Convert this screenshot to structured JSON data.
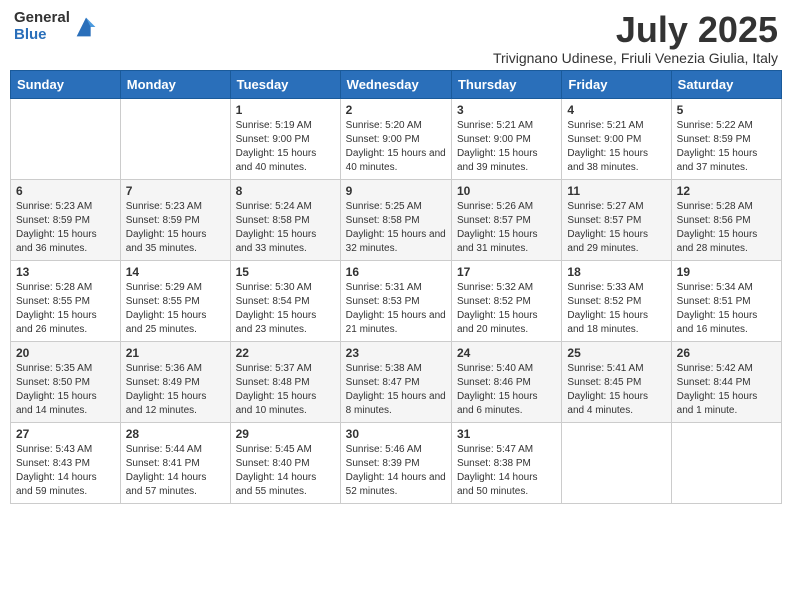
{
  "header": {
    "logo_general": "General",
    "logo_blue": "Blue",
    "month_title": "July 2025",
    "subtitle": "Trivignano Udinese, Friuli Venezia Giulia, Italy"
  },
  "days_of_week": [
    "Sunday",
    "Monday",
    "Tuesday",
    "Wednesday",
    "Thursday",
    "Friday",
    "Saturday"
  ],
  "weeks": [
    [
      {
        "day": "",
        "info": ""
      },
      {
        "day": "",
        "info": ""
      },
      {
        "day": "1",
        "info": "Sunrise: 5:19 AM\nSunset: 9:00 PM\nDaylight: 15 hours and 40 minutes."
      },
      {
        "day": "2",
        "info": "Sunrise: 5:20 AM\nSunset: 9:00 PM\nDaylight: 15 hours and 40 minutes."
      },
      {
        "day": "3",
        "info": "Sunrise: 5:21 AM\nSunset: 9:00 PM\nDaylight: 15 hours and 39 minutes."
      },
      {
        "day": "4",
        "info": "Sunrise: 5:21 AM\nSunset: 9:00 PM\nDaylight: 15 hours and 38 minutes."
      },
      {
        "day": "5",
        "info": "Sunrise: 5:22 AM\nSunset: 8:59 PM\nDaylight: 15 hours and 37 minutes."
      }
    ],
    [
      {
        "day": "6",
        "info": "Sunrise: 5:23 AM\nSunset: 8:59 PM\nDaylight: 15 hours and 36 minutes."
      },
      {
        "day": "7",
        "info": "Sunrise: 5:23 AM\nSunset: 8:59 PM\nDaylight: 15 hours and 35 minutes."
      },
      {
        "day": "8",
        "info": "Sunrise: 5:24 AM\nSunset: 8:58 PM\nDaylight: 15 hours and 33 minutes."
      },
      {
        "day": "9",
        "info": "Sunrise: 5:25 AM\nSunset: 8:58 PM\nDaylight: 15 hours and 32 minutes."
      },
      {
        "day": "10",
        "info": "Sunrise: 5:26 AM\nSunset: 8:57 PM\nDaylight: 15 hours and 31 minutes."
      },
      {
        "day": "11",
        "info": "Sunrise: 5:27 AM\nSunset: 8:57 PM\nDaylight: 15 hours and 29 minutes."
      },
      {
        "day": "12",
        "info": "Sunrise: 5:28 AM\nSunset: 8:56 PM\nDaylight: 15 hours and 28 minutes."
      }
    ],
    [
      {
        "day": "13",
        "info": "Sunrise: 5:28 AM\nSunset: 8:55 PM\nDaylight: 15 hours and 26 minutes."
      },
      {
        "day": "14",
        "info": "Sunrise: 5:29 AM\nSunset: 8:55 PM\nDaylight: 15 hours and 25 minutes."
      },
      {
        "day": "15",
        "info": "Sunrise: 5:30 AM\nSunset: 8:54 PM\nDaylight: 15 hours and 23 minutes."
      },
      {
        "day": "16",
        "info": "Sunrise: 5:31 AM\nSunset: 8:53 PM\nDaylight: 15 hours and 21 minutes."
      },
      {
        "day": "17",
        "info": "Sunrise: 5:32 AM\nSunset: 8:52 PM\nDaylight: 15 hours and 20 minutes."
      },
      {
        "day": "18",
        "info": "Sunrise: 5:33 AM\nSunset: 8:52 PM\nDaylight: 15 hours and 18 minutes."
      },
      {
        "day": "19",
        "info": "Sunrise: 5:34 AM\nSunset: 8:51 PM\nDaylight: 15 hours and 16 minutes."
      }
    ],
    [
      {
        "day": "20",
        "info": "Sunrise: 5:35 AM\nSunset: 8:50 PM\nDaylight: 15 hours and 14 minutes."
      },
      {
        "day": "21",
        "info": "Sunrise: 5:36 AM\nSunset: 8:49 PM\nDaylight: 15 hours and 12 minutes."
      },
      {
        "day": "22",
        "info": "Sunrise: 5:37 AM\nSunset: 8:48 PM\nDaylight: 15 hours and 10 minutes."
      },
      {
        "day": "23",
        "info": "Sunrise: 5:38 AM\nSunset: 8:47 PM\nDaylight: 15 hours and 8 minutes."
      },
      {
        "day": "24",
        "info": "Sunrise: 5:40 AM\nSunset: 8:46 PM\nDaylight: 15 hours and 6 minutes."
      },
      {
        "day": "25",
        "info": "Sunrise: 5:41 AM\nSunset: 8:45 PM\nDaylight: 15 hours and 4 minutes."
      },
      {
        "day": "26",
        "info": "Sunrise: 5:42 AM\nSunset: 8:44 PM\nDaylight: 15 hours and 1 minute."
      }
    ],
    [
      {
        "day": "27",
        "info": "Sunrise: 5:43 AM\nSunset: 8:43 PM\nDaylight: 14 hours and 59 minutes."
      },
      {
        "day": "28",
        "info": "Sunrise: 5:44 AM\nSunset: 8:41 PM\nDaylight: 14 hours and 57 minutes."
      },
      {
        "day": "29",
        "info": "Sunrise: 5:45 AM\nSunset: 8:40 PM\nDaylight: 14 hours and 55 minutes."
      },
      {
        "day": "30",
        "info": "Sunrise: 5:46 AM\nSunset: 8:39 PM\nDaylight: 14 hours and 52 minutes."
      },
      {
        "day": "31",
        "info": "Sunrise: 5:47 AM\nSunset: 8:38 PM\nDaylight: 14 hours and 50 minutes."
      },
      {
        "day": "",
        "info": ""
      },
      {
        "day": "",
        "info": ""
      }
    ]
  ]
}
